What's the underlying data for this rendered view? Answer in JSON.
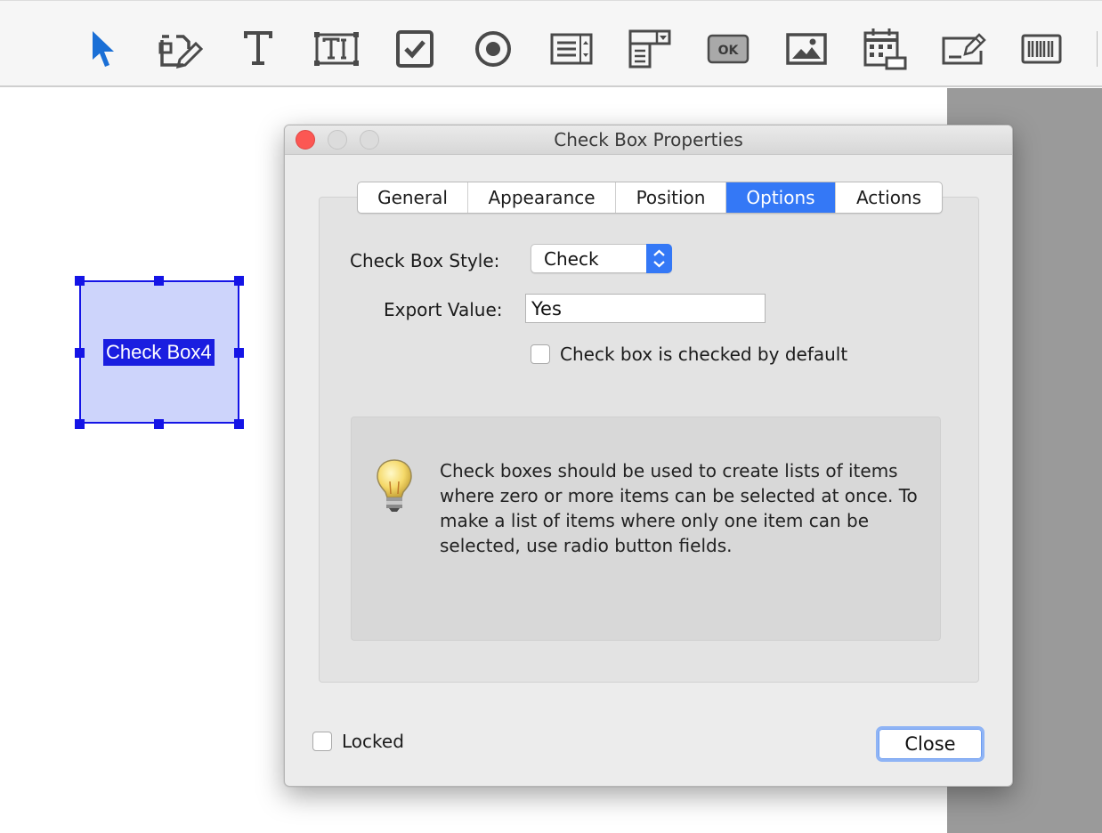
{
  "toolbar": {
    "tools": [
      {
        "name": "select-tool",
        "icon": "cursor-arrow-icon",
        "color": "#1a6fd6"
      },
      {
        "name": "edit-form-tool",
        "icon": "form-edit-icon"
      },
      {
        "name": "text-tool",
        "icon": "text-t-icon"
      },
      {
        "name": "text-field-tool",
        "icon": "text-field-icon"
      },
      {
        "name": "check-box-tool",
        "icon": "checkbox-icon"
      },
      {
        "name": "radio-button-tool",
        "icon": "radio-button-icon"
      },
      {
        "name": "list-box-tool",
        "icon": "list-box-icon"
      },
      {
        "name": "dropdown-tool",
        "icon": "dropdown-icon"
      },
      {
        "name": "button-tool",
        "icon": "ok-button-icon",
        "label": "OK"
      },
      {
        "name": "image-tool",
        "icon": "image-icon"
      },
      {
        "name": "date-field-tool",
        "icon": "calendar-icon"
      },
      {
        "name": "signature-tool",
        "icon": "signature-pen-icon"
      },
      {
        "name": "barcode-tool",
        "icon": "barcode-icon"
      }
    ]
  },
  "canvas": {
    "field_label": "Check Box4",
    "field_fill": "#cdd4fb",
    "selection_color": "#1414e6"
  },
  "dialog": {
    "title": "Check Box Properties",
    "tabs": [
      {
        "label": "General",
        "active": false
      },
      {
        "label": "Appearance",
        "active": false
      },
      {
        "label": "Position",
        "active": false
      },
      {
        "label": "Options",
        "active": true
      },
      {
        "label": "Actions",
        "active": false
      }
    ],
    "style_label": "Check Box Style:",
    "style_value": "Check",
    "export_label": "Export Value:",
    "export_value": "Yes",
    "default_checked_label": "Check box is checked by default",
    "default_checked": false,
    "hint_icon": "lightbulb-icon",
    "hint_text": "Check boxes should be used to create lists of items where zero or more items can be selected at once. To make a list of items where only one item can be selected, use radio button fields.",
    "locked_label": "Locked",
    "locked": false,
    "close_label": "Close",
    "accent": "#3478f6"
  }
}
